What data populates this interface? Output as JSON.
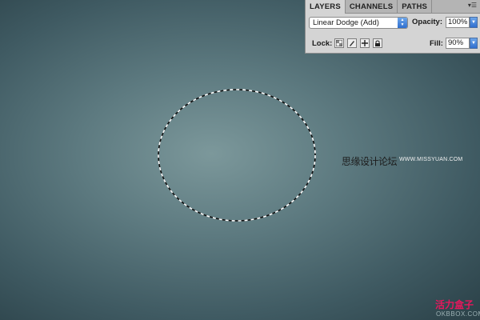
{
  "panel": {
    "tabs": [
      "LAYERS",
      "CHANNELS",
      "PATHS"
    ],
    "active_tab": "LAYERS",
    "menu_icon": "panel-menu-icon",
    "blend_mode": "Linear Dodge (Add)",
    "opacity_label": "Opacity:",
    "opacity_value": "100%",
    "lock_label": "Lock:",
    "fill_label": "Fill:",
    "fill_value": "90%",
    "lock_icons": [
      "lock-transparent-pixels-icon",
      "lock-image-pixels-icon",
      "lock-position-icon",
      "lock-all-icon"
    ]
  },
  "watermark": {
    "text": "思缘设计论坛",
    "url": "WWW.MISSYUAN.COM"
  },
  "corner_mark": {
    "text": "活力盒子",
    "sub": "OKBBOX.COM"
  },
  "colors": {
    "canvas_center": "#7c989b",
    "canvas_edge": "#2a4047",
    "panel_bg": "#d4d4d4",
    "accent_blue": "#2f6fcf",
    "corner_mark": "#e8175d"
  }
}
